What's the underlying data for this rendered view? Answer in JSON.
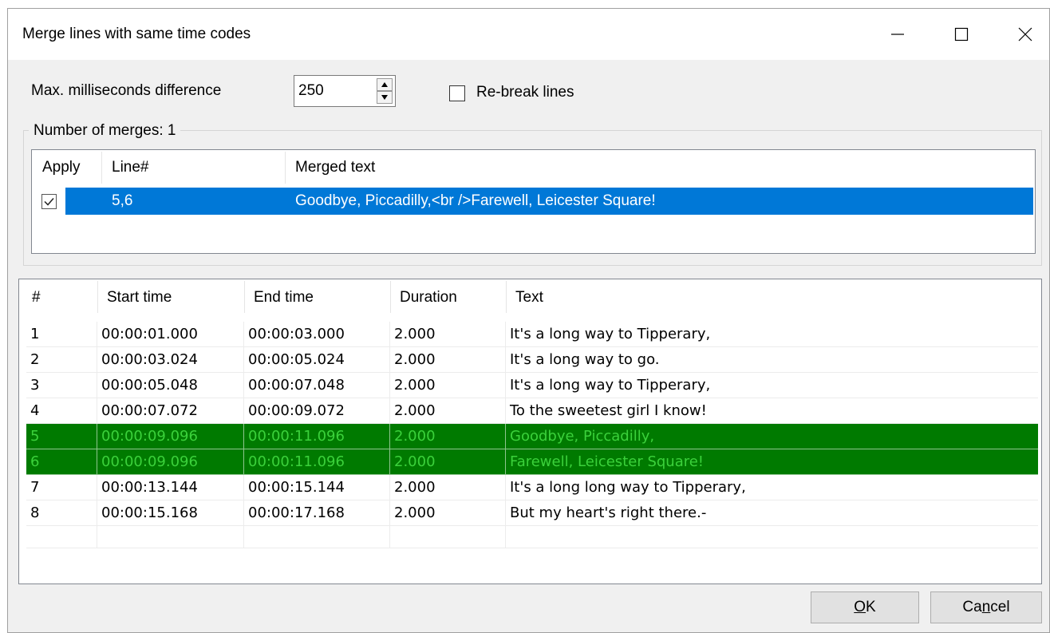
{
  "window": {
    "title": "Merge lines with same time codes"
  },
  "controls": {
    "max_ms_label": "Max. milliseconds difference",
    "max_ms_value": "250",
    "rebreak_label": "Re-break lines",
    "rebreak_checked": false
  },
  "merges": {
    "group_label": "Number of merges: 1",
    "columns": [
      "Apply",
      "Line#",
      "Merged text"
    ],
    "rows": [
      {
        "apply": true,
        "lines": "5,6",
        "text": "Goodbye, Piccadilly,<br />Farewell, Leicester Square!"
      }
    ]
  },
  "subtitles": {
    "columns": [
      "#",
      "Start time",
      "End time",
      "Duration",
      "Text"
    ],
    "rows": [
      {
        "num": "1",
        "start": "00:00:01.000",
        "end": "00:00:03.000",
        "duration": "2.000",
        "text": "It's a long way to Tipperary,",
        "highlight": false
      },
      {
        "num": "2",
        "start": "00:00:03.024",
        "end": "00:00:05.024",
        "duration": "2.000",
        "text": "It's a long way to go.",
        "highlight": false
      },
      {
        "num": "3",
        "start": "00:00:05.048",
        "end": "00:00:07.048",
        "duration": "2.000",
        "text": "It's a long way to Tipperary,",
        "highlight": false
      },
      {
        "num": "4",
        "start": "00:00:07.072",
        "end": "00:00:09.072",
        "duration": "2.000",
        "text": "To the sweetest girl I know!",
        "highlight": false
      },
      {
        "num": "5",
        "start": "00:00:09.096",
        "end": "00:00:11.096",
        "duration": "2.000",
        "text": "Goodbye, Piccadilly,",
        "highlight": true
      },
      {
        "num": "6",
        "start": "00:00:09.096",
        "end": "00:00:11.096",
        "duration": "2.000",
        "text": "Farewell, Leicester Square!",
        "highlight": true
      },
      {
        "num": "7",
        "start": "00:00:13.144",
        "end": "00:00:15.144",
        "duration": "2.000",
        "text": "It's a long long way to Tipperary,",
        "highlight": false
      },
      {
        "num": "8",
        "start": "00:00:15.168",
        "end": "00:00:17.168",
        "duration": "2.000",
        "text": "But my heart's right there.-",
        "highlight": false
      }
    ]
  },
  "buttons": {
    "ok": {
      "pre": "",
      "accel": "O",
      "post": "K"
    },
    "cancel": {
      "pre": "Ca",
      "accel": "n",
      "post": "cel"
    }
  },
  "icons": {
    "minimize": "minimize-icon",
    "maximize": "maximize-icon",
    "close": "close-icon",
    "spin_up": "triangle-up-icon",
    "spin_down": "triangle-down-icon",
    "checkmark": "checkmark-icon"
  },
  "colors": {
    "selection": "#0078d7",
    "merge_highlight_bg": "#007a00",
    "merge_highlight_text": "#3bd13b",
    "window_bg": "#f0f0f0"
  }
}
